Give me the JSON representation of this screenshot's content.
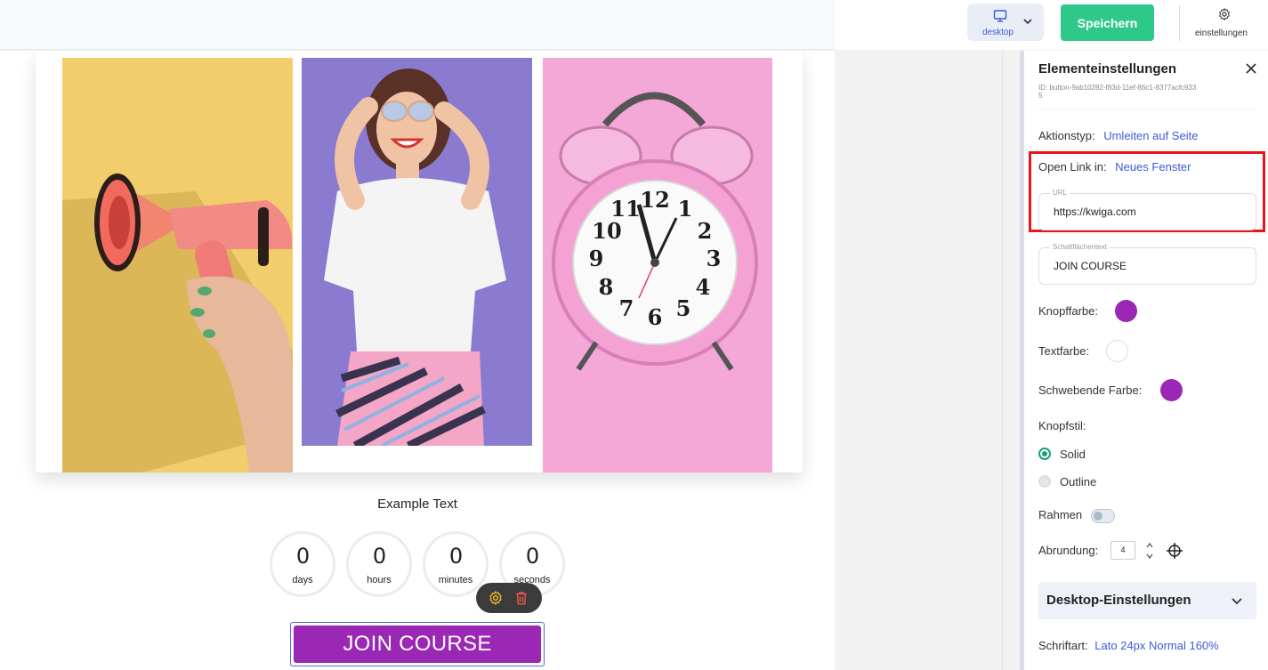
{
  "topbar": {
    "device_label": "desktop",
    "save_label": "Speichern",
    "settings_label": "einstellungen"
  },
  "canvas": {
    "example_text": "Example Text",
    "timer": [
      {
        "value": "0",
        "unit": "days"
      },
      {
        "value": "0",
        "unit": "hours"
      },
      {
        "value": "0",
        "unit": "minutes"
      },
      {
        "value": "0",
        "unit": "seconds"
      }
    ],
    "join_button_label": "JOIN COURSE"
  },
  "panel": {
    "title": "Elementeinstellungen",
    "element_id": "ID: button-9ab10282-f83d-11ef-86c1-8377acfc9335",
    "action_type_label": "Aktionstyp:",
    "action_type_value": "Umleiten auf Seite",
    "open_link_label": "Open Link in:",
    "open_link_value": "Neues Fenster",
    "url_label": "URL",
    "url_value": "https://kwiga.com",
    "button_text_label": "Schaltflächentext",
    "button_text_value": "JOIN COURSE",
    "button_color_label": "Knopffarbe:",
    "text_color_label": "Textfarbe:",
    "hover_color_label": "Schwebende Farbe:",
    "button_style_label": "Knopfstil:",
    "style_options": [
      "Solid",
      "Outline"
    ],
    "border_label": "Rahmen",
    "rounding_label": "Abrundung:",
    "rounding_value": "4",
    "desktop_settings_label": "Desktop-Einstellungen",
    "font_label": "Schriftart:",
    "font_value": "Lato 24px Normal 160%"
  },
  "colors": {
    "button_color": "#9b27b5",
    "text_color": "#ffffff",
    "hover_color": "#9b27b5",
    "save_green": "#2ec98a",
    "link_blue": "#3c5bd6"
  }
}
